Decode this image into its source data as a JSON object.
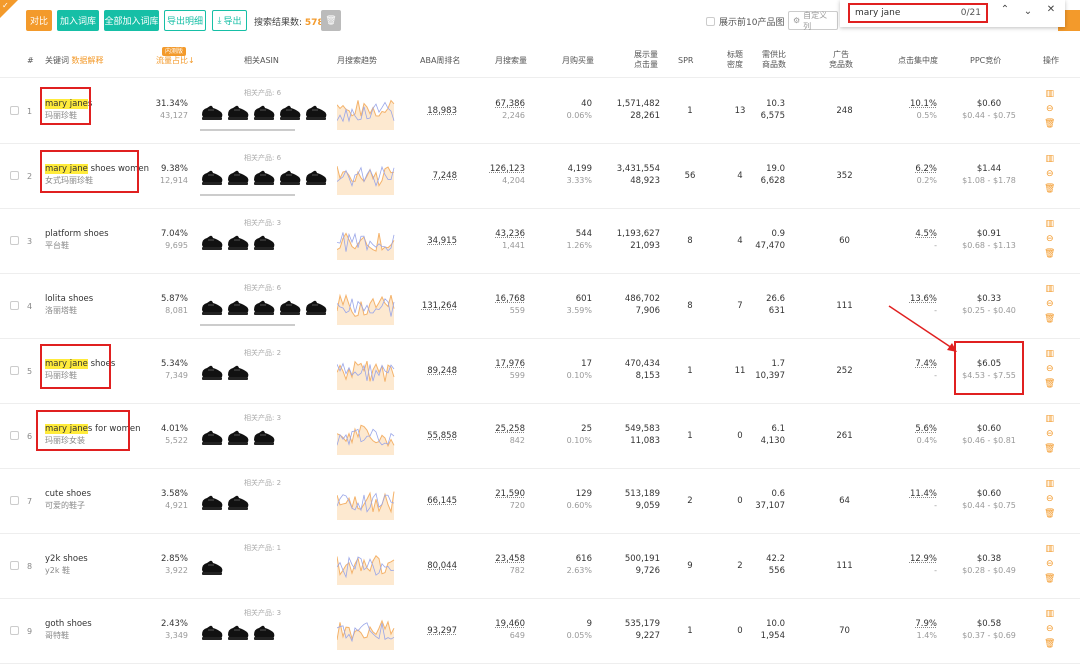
{
  "toolbar": {
    "compare": "对比",
    "add_to_lib": "加入词库",
    "add_all": "全部加入词库",
    "export_detail": "导出明细",
    "export": "导出",
    "result_label": "搜索结果数:",
    "result_count": "578",
    "show_top10": "展示前10产品图",
    "custom_cols": "自定义列"
  },
  "find": {
    "query": "mary jane",
    "count": "0/21"
  },
  "header": {
    "idx": "#",
    "keyword": "关键词",
    "keyword_note": "数据解释",
    "traffic_badge": "内测版",
    "traffic": "流量占比↓",
    "asin": "相关ASIN",
    "trend": "月搜索趋势",
    "aba": "ABA周排名",
    "monthly_search": "月搜索量",
    "monthly_buy": "月购买量",
    "display_click_1": "展示量",
    "display_click_2": "点击量",
    "spr": "SPR",
    "title_density_1": "标题",
    "title_density_2": "密度",
    "supply_1": "需供比",
    "supply_2": "商品数",
    "ad_1": "广告",
    "ad_2": "竞品数",
    "click_conc": "点击集中度",
    "ppc": "PPC竞价",
    "ops": "操作"
  },
  "rows": [
    {
      "idx": "1",
      "kw_hl": "mary jane",
      "kw_rest": "s",
      "cn": "玛丽珍鞋",
      "traffic": "31.34%",
      "traffic_sub": "43,127",
      "asin_label": "相关产品: 6",
      "shoes": 5,
      "aba": "18,983",
      "ms": "67,386",
      "ms_sub": "2,246",
      "mb": "40",
      "mb_sub": "0.06%",
      "dc": "1,571,482",
      "dc_sub": "28,261",
      "spr": "1",
      "td": "13",
      "sr": "10.3",
      "sr_sub": "6,575",
      "ad": "248",
      "cc": "10.1%",
      "cc_sub": "0.5%",
      "ppc": "$0.60",
      "ppc_sub": "$0.44 - $0.75"
    },
    {
      "idx": "2",
      "kw_hl": "mary jane",
      "kw_rest": " shoes women",
      "cn": "女式玛丽珍鞋",
      "traffic": "9.38%",
      "traffic_sub": "12,914",
      "asin_label": "相关产品: 6",
      "shoes": 5,
      "aba": "7,248",
      "ms": "126,123",
      "ms_sub": "4,204",
      "mb": "4,199",
      "mb_sub": "3.33%",
      "dc": "3,431,554",
      "dc_sub": "48,923",
      "spr": "56",
      "td": "4",
      "sr": "19.0",
      "sr_sub": "6,628",
      "ad": "352",
      "cc": "6.2%",
      "cc_sub": "0.2%",
      "ppc": "$1.44",
      "ppc_sub": "$1.08 - $1.78"
    },
    {
      "idx": "3",
      "kw_hl": "",
      "kw_rest": "platform shoes",
      "cn": "平台鞋",
      "traffic": "7.04%",
      "traffic_sub": "9,695",
      "asin_label": "相关产品: 3",
      "shoes": 3,
      "aba": "34,915",
      "ms": "43,236",
      "ms_sub": "1,441",
      "mb": "544",
      "mb_sub": "1.26%",
      "dc": "1,193,627",
      "dc_sub": "21,093",
      "spr": "8",
      "td": "4",
      "sr": "0.9",
      "sr_sub": "47,470",
      "ad": "60",
      "cc": "4.5%",
      "cc_sub": "-",
      "ppc": "$0.91",
      "ppc_sub": "$0.68 - $1.13"
    },
    {
      "idx": "4",
      "kw_hl": "",
      "kw_rest": "lolita shoes",
      "cn": "洛丽塔鞋",
      "traffic": "5.87%",
      "traffic_sub": "8,081",
      "asin_label": "相关产品: 6",
      "shoes": 5,
      "aba": "131,264",
      "ms": "16,768",
      "ms_sub": "559",
      "mb": "601",
      "mb_sub": "3.59%",
      "dc": "486,702",
      "dc_sub": "7,906",
      "spr": "8",
      "td": "7",
      "sr": "26.6",
      "sr_sub": "631",
      "ad": "111",
      "cc": "13.6%",
      "cc_sub": "-",
      "ppc": "$0.33",
      "ppc_sub": "$0.25 - $0.40"
    },
    {
      "idx": "5",
      "kw_hl": "mary jane",
      "kw_rest": " shoes",
      "cn": "玛丽珍鞋",
      "traffic": "5.34%",
      "traffic_sub": "7,349",
      "asin_label": "相关产品: 2",
      "shoes": 2,
      "aba": "89,248",
      "ms": "17,976",
      "ms_sub": "599",
      "mb": "17",
      "mb_sub": "0.10%",
      "dc": "470,434",
      "dc_sub": "8,153",
      "spr": "1",
      "td": "11",
      "sr": "1.7",
      "sr_sub": "10,397",
      "ad": "252",
      "cc": "7.4%",
      "cc_sub": "-",
      "ppc": "$6.05",
      "ppc_sub": "$4.53 - $7.55"
    },
    {
      "idx": "6",
      "kw_hl": "mary jane",
      "kw_rest": "s for women",
      "cn": "玛丽珍女装",
      "traffic": "4.01%",
      "traffic_sub": "5,522",
      "asin_label": "相关产品: 3",
      "shoes": 3,
      "aba": "55,858",
      "ms": "25,258",
      "ms_sub": "842",
      "mb": "25",
      "mb_sub": "0.10%",
      "dc": "549,583",
      "dc_sub": "11,083",
      "spr": "1",
      "td": "0",
      "sr": "6.1",
      "sr_sub": "4,130",
      "ad": "261",
      "cc": "5.6%",
      "cc_sub": "0.4%",
      "ppc": "$0.60",
      "ppc_sub": "$0.46 - $0.81"
    },
    {
      "idx": "7",
      "kw_hl": "",
      "kw_rest": "cute shoes",
      "cn": "可爱的鞋子",
      "traffic": "3.58%",
      "traffic_sub": "4,921",
      "asin_label": "相关产品: 2",
      "shoes": 2,
      "aba": "66,145",
      "ms": "21,590",
      "ms_sub": "720",
      "mb": "129",
      "mb_sub": "0.60%",
      "dc": "513,189",
      "dc_sub": "9,059",
      "spr": "2",
      "td": "0",
      "sr": "0.6",
      "sr_sub": "37,107",
      "ad": "64",
      "cc": "11.4%",
      "cc_sub": "-",
      "ppc": "$0.60",
      "ppc_sub": "$0.44 - $0.75"
    },
    {
      "idx": "8",
      "kw_hl": "",
      "kw_rest": "y2k shoes",
      "cn": "y2k 鞋",
      "traffic": "2.85%",
      "traffic_sub": "3,922",
      "asin_label": "相关产品: 1",
      "shoes": 1,
      "aba": "80,044",
      "ms": "23,458",
      "ms_sub": "782",
      "mb": "616",
      "mb_sub": "2.63%",
      "dc": "500,191",
      "dc_sub": "9,726",
      "spr": "9",
      "td": "2",
      "sr": "42.2",
      "sr_sub": "556",
      "ad": "111",
      "cc": "12.9%",
      "cc_sub": "-",
      "ppc": "$0.38",
      "ppc_sub": "$0.28 - $0.49"
    },
    {
      "idx": "9",
      "kw_hl": "",
      "kw_rest": "goth shoes",
      "cn": "哥特鞋",
      "traffic": "2.43%",
      "traffic_sub": "3,349",
      "asin_label": "相关产品: 3",
      "shoes": 3,
      "aba": "93,297",
      "ms": "19,460",
      "ms_sub": "649",
      "mb": "9",
      "mb_sub": "0.05%",
      "dc": "535,179",
      "dc_sub": "9,227",
      "spr": "1",
      "td": "0",
      "sr": "10.0",
      "sr_sub": "1,954",
      "ad": "70",
      "cc": "7.9%",
      "cc_sub": "1.4%",
      "ppc": "$0.58",
      "ppc_sub": "$0.37 - $0.69"
    }
  ],
  "colors": {
    "accent": "#f39a2b",
    "teal": "#16bfa6",
    "highlight": "#ffeb3b",
    "annotation": "#e02020"
  }
}
